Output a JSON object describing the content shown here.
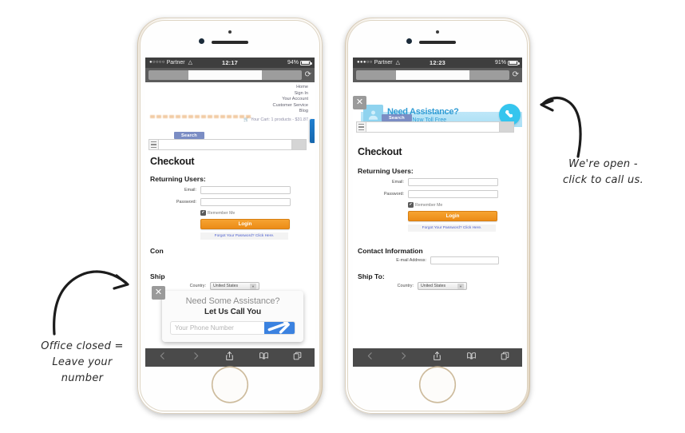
{
  "annotations": {
    "left": {
      "line1": "Office closed =",
      "line2": "Leave your",
      "line3": "number"
    },
    "right": {
      "line1": "We're open -",
      "line2": "click to call us."
    }
  },
  "colors": {
    "accent_blue": "#3b82e0",
    "banner_cyan": "#35c5ee",
    "banner_text_blue": "#2e9bd4",
    "login_orange": "#ec8c17",
    "online_green": "#4fbf2a",
    "tab_blue": "#1f7fd0",
    "search_tab": "#7b8dc4",
    "link_blue": "#4b5ecf"
  },
  "phone1": {
    "status": {
      "signal_dots": "●○○○○",
      "carrier": "Partner",
      "wifi_icon": "wifi-icon",
      "time": "12:17",
      "battery_percent": "94%",
      "battery_level": 94
    },
    "browser": {
      "reload_icon": "reload-icon",
      "url_value": ""
    },
    "nav_links": [
      "Home",
      "Sign In",
      "Your Account",
      "Customer Service",
      "Blog"
    ],
    "cart": {
      "cart_icon": "cart-icon",
      "text": "Your Cart: 1 products - $31.87"
    },
    "search": {
      "tab_label": "Search",
      "menu_icon": "hamburger-icon",
      "input_value": "",
      "placeholder": ""
    },
    "page": {
      "title": "Checkout",
      "returning_users": "Returning Users:",
      "email_label": "Email:",
      "password_label": "Password:",
      "remember_label": "Remember Me",
      "remember_checked": true,
      "check_glyph": "✔",
      "login_label": "Login",
      "forgot_link": "Forgot Your Password? Click Here.",
      "contact_heading": "Con",
      "ship_heading": "Ship",
      "country_label": "Country:",
      "country_value": "United States"
    },
    "popup": {
      "close_glyph": "✕",
      "title": "Need Some Assistance?",
      "subtitle": "Let Us Call You",
      "phone_placeholder": "Your Phone Number",
      "phone_value": "",
      "send_icon": "send-arrow-icon"
    },
    "toolbar": {
      "back_icon": "back-chevron-icon",
      "forward_icon": "forward-chevron-icon",
      "share_icon": "share-icon",
      "bookmarks_icon": "book-icon",
      "tabs_icon": "tabs-icon"
    }
  },
  "phone2": {
    "status": {
      "signal_dots": "●●●○○",
      "carrier": "Partner",
      "wifi_icon": "wifi-icon",
      "time": "12:23",
      "battery_percent": "91%",
      "battery_level": 91
    },
    "browser": {
      "reload_icon": "reload-icon",
      "url_value": ""
    },
    "banner": {
      "close_glyph": "✕",
      "avatar_icon": "person-avatar-icon",
      "title": "Need Assistance?",
      "subtitle": "Call Us Now Toll Free",
      "status_dot": "online-green-dot",
      "call_icon": "phone-handset-icon"
    },
    "search": {
      "tab_label": "Search",
      "menu_icon": "hamburger-icon",
      "input_value": "",
      "placeholder": ""
    },
    "page": {
      "title": "Checkout",
      "returning_users": "Returning Users:",
      "email_label": "Email:",
      "password_label": "Password:",
      "remember_label": "Remember Me",
      "remember_checked": true,
      "check_glyph": "✔",
      "login_label": "Login",
      "forgot_link": "Forgot Your Password? Click Here.",
      "contact_heading": "Contact Information",
      "email_address_label": "E-mail Address:",
      "email_address_value": "",
      "ship_heading": "Ship To:",
      "country_label": "Country:",
      "country_value": "United States"
    },
    "toolbar": {
      "back_icon": "back-chevron-icon",
      "forward_icon": "forward-chevron-icon",
      "share_icon": "share-icon",
      "bookmarks_icon": "book-icon",
      "tabs_icon": "tabs-icon"
    }
  }
}
